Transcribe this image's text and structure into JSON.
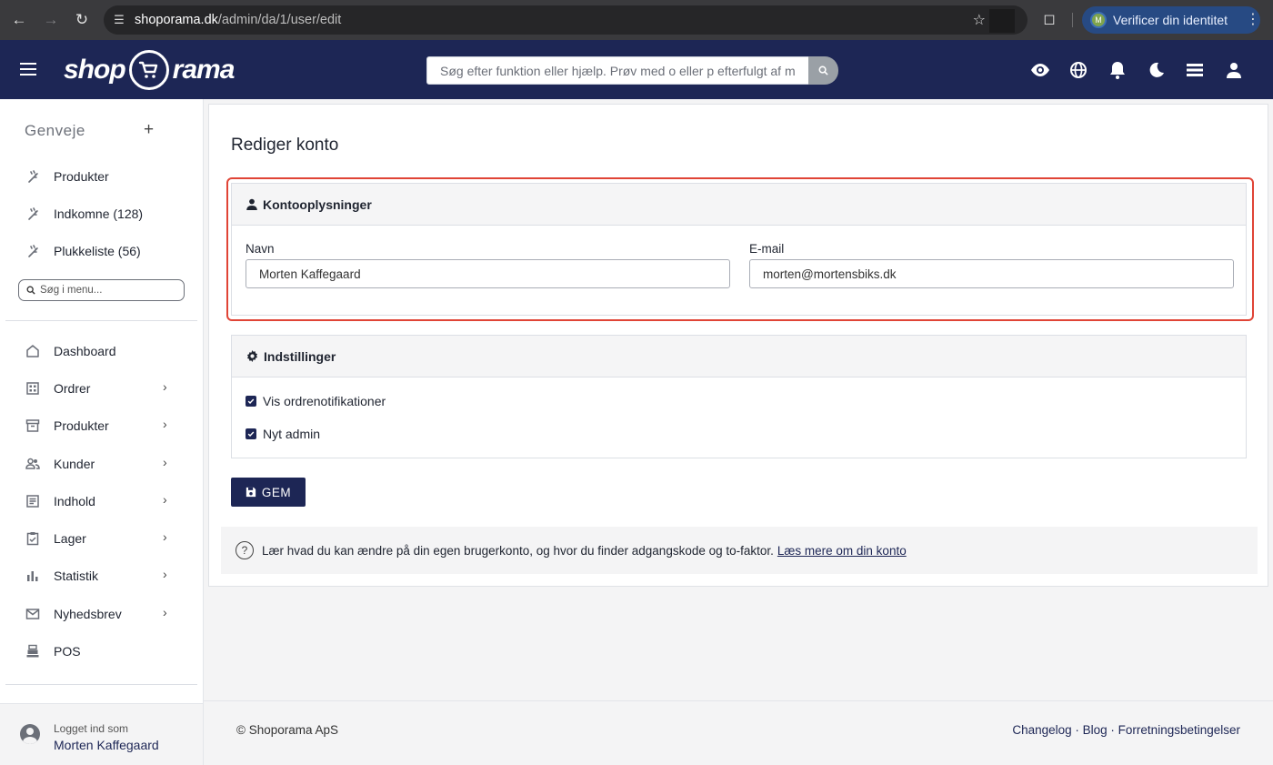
{
  "browser": {
    "url_domain": "shoporama.dk",
    "url_path": "/admin/da/1/user/edit",
    "profile_initial": "M",
    "verify_label": "Verificer din identitet"
  },
  "header": {
    "logo_left": "shop",
    "logo_right": "rama",
    "search_placeholder": "Søg efter funktion eller hjælp. Prøv med o eller p efterfulgt af mellemrum",
    "icons": [
      "eye-icon",
      "globe-icon",
      "bell-icon",
      "moon-icon",
      "stack-icon",
      "user-icon"
    ]
  },
  "sidebar": {
    "shortcuts_title": "Genveje",
    "shortcuts": [
      {
        "label": "Produkter"
      },
      {
        "label": "Indkomne (128)"
      },
      {
        "label": "Plukkeliste (56)"
      }
    ],
    "menu_search_placeholder": "Søg i menu...",
    "items": [
      {
        "label": "Dashboard",
        "icon": "home-icon"
      },
      {
        "label": "Ordrer",
        "icon": "grid-icon"
      },
      {
        "label": "Produkter",
        "icon": "archive-icon"
      },
      {
        "label": "Kunder",
        "icon": "people-icon"
      },
      {
        "label": "Indhold",
        "icon": "document-icon"
      },
      {
        "label": "Lager",
        "icon": "clipboard-icon"
      },
      {
        "label": "Statistik",
        "icon": "bar-chart-icon"
      },
      {
        "label": "Nyhedsbrev",
        "icon": "mail-icon"
      },
      {
        "label": "POS",
        "icon": "register-icon"
      }
    ],
    "user": {
      "logged_in_label": "Logget ind som",
      "name": "Morten Kaffegaard"
    }
  },
  "main": {
    "title": "Rediger konto",
    "account_panel": {
      "title": "Kontooplysninger",
      "name_label": "Navn",
      "name_value": "Morten Kaffegaard",
      "email_label": "E-mail",
      "email_value": "morten@mortensbiks.dk"
    },
    "settings_panel": {
      "title": "Indstillinger",
      "options": [
        {
          "label": "Vis ordrenotifikationer",
          "checked": true
        },
        {
          "label": "Nyt admin",
          "checked": true
        }
      ]
    },
    "save_label": "GEM",
    "info": {
      "text": "Lær hvad du kan ændre på din egen brugerkonto, og hvor du finder adgangskode og to-faktor.",
      "link": "Læs mere om din konto"
    }
  },
  "footer": {
    "copyright": "© Shoporama ApS",
    "links": "Changelog · Blog · Forretningsbetingelser"
  },
  "colors": {
    "brand_navy": "#1d2655",
    "highlight_red": "#e04436"
  }
}
